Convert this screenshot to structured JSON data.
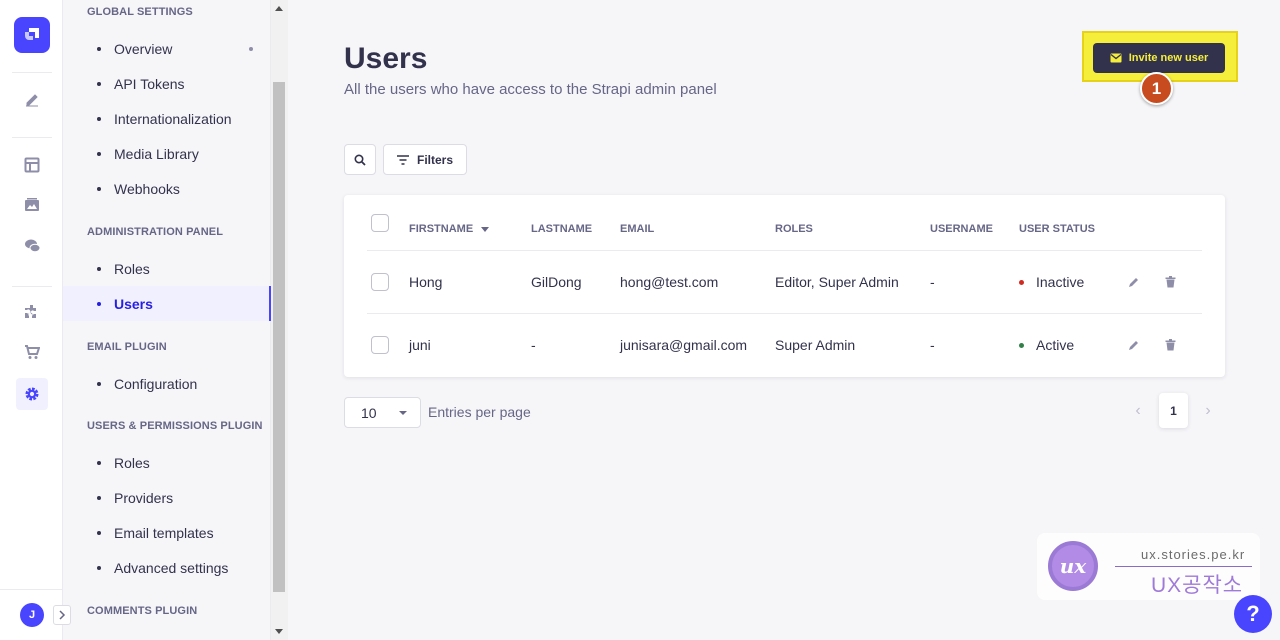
{
  "subnav": {
    "groups": [
      {
        "title": "GLOBAL SETTINGS",
        "items": [
          "Overview",
          "API Tokens",
          "Internationalization",
          "Media Library",
          "Webhooks"
        ]
      },
      {
        "title": "ADMINISTRATION PANEL",
        "items": [
          "Roles",
          "Users"
        ]
      },
      {
        "title": "EMAIL PLUGIN",
        "items": [
          "Configuration"
        ]
      },
      {
        "title": "USERS & PERMISSIONS PLUGIN",
        "items": [
          "Roles",
          "Providers",
          "Email templates",
          "Advanced settings"
        ]
      },
      {
        "title": "COMMENTS PLUGIN",
        "items": []
      }
    ],
    "active_item": "Users"
  },
  "rail": {
    "icons": [
      "strapi-logo-icon",
      "content-manager-icon",
      "content-type-builder-icon",
      "media-library-icon",
      "comments-icon",
      "plugins-icon",
      "marketplace-icon",
      "settings-icon"
    ],
    "user_initial": "J"
  },
  "header": {
    "title": "Users",
    "subtitle": "All the users who have access to the Strapi admin panel",
    "invite_label": "Invite new user",
    "step_number": "1"
  },
  "toolbar": {
    "filters_label": "Filters"
  },
  "table": {
    "columns": [
      "FIRSTNAME",
      "LASTNAME",
      "EMAIL",
      "ROLES",
      "USERNAME",
      "USER STATUS"
    ],
    "rows": [
      {
        "firstname": "Hong",
        "lastname": "GilDong",
        "email": "hong@test.com",
        "roles": "Editor, Super Admin",
        "username": "-",
        "status": "Inactive",
        "status_color": "#d02b20"
      },
      {
        "firstname": "juni",
        "lastname": "-",
        "email": "junisara@gmail.com",
        "roles": "Super Admin",
        "username": "-",
        "status": "Active",
        "status_color": "#328048"
      }
    ]
  },
  "pagination": {
    "per_page": "10",
    "per_page_label": "Entries per page",
    "current_page": "1"
  },
  "watermark": {
    "mark": "ux",
    "url": "ux.stories.pe.kr",
    "brand": "UX공작소"
  },
  "help_label": "?"
}
